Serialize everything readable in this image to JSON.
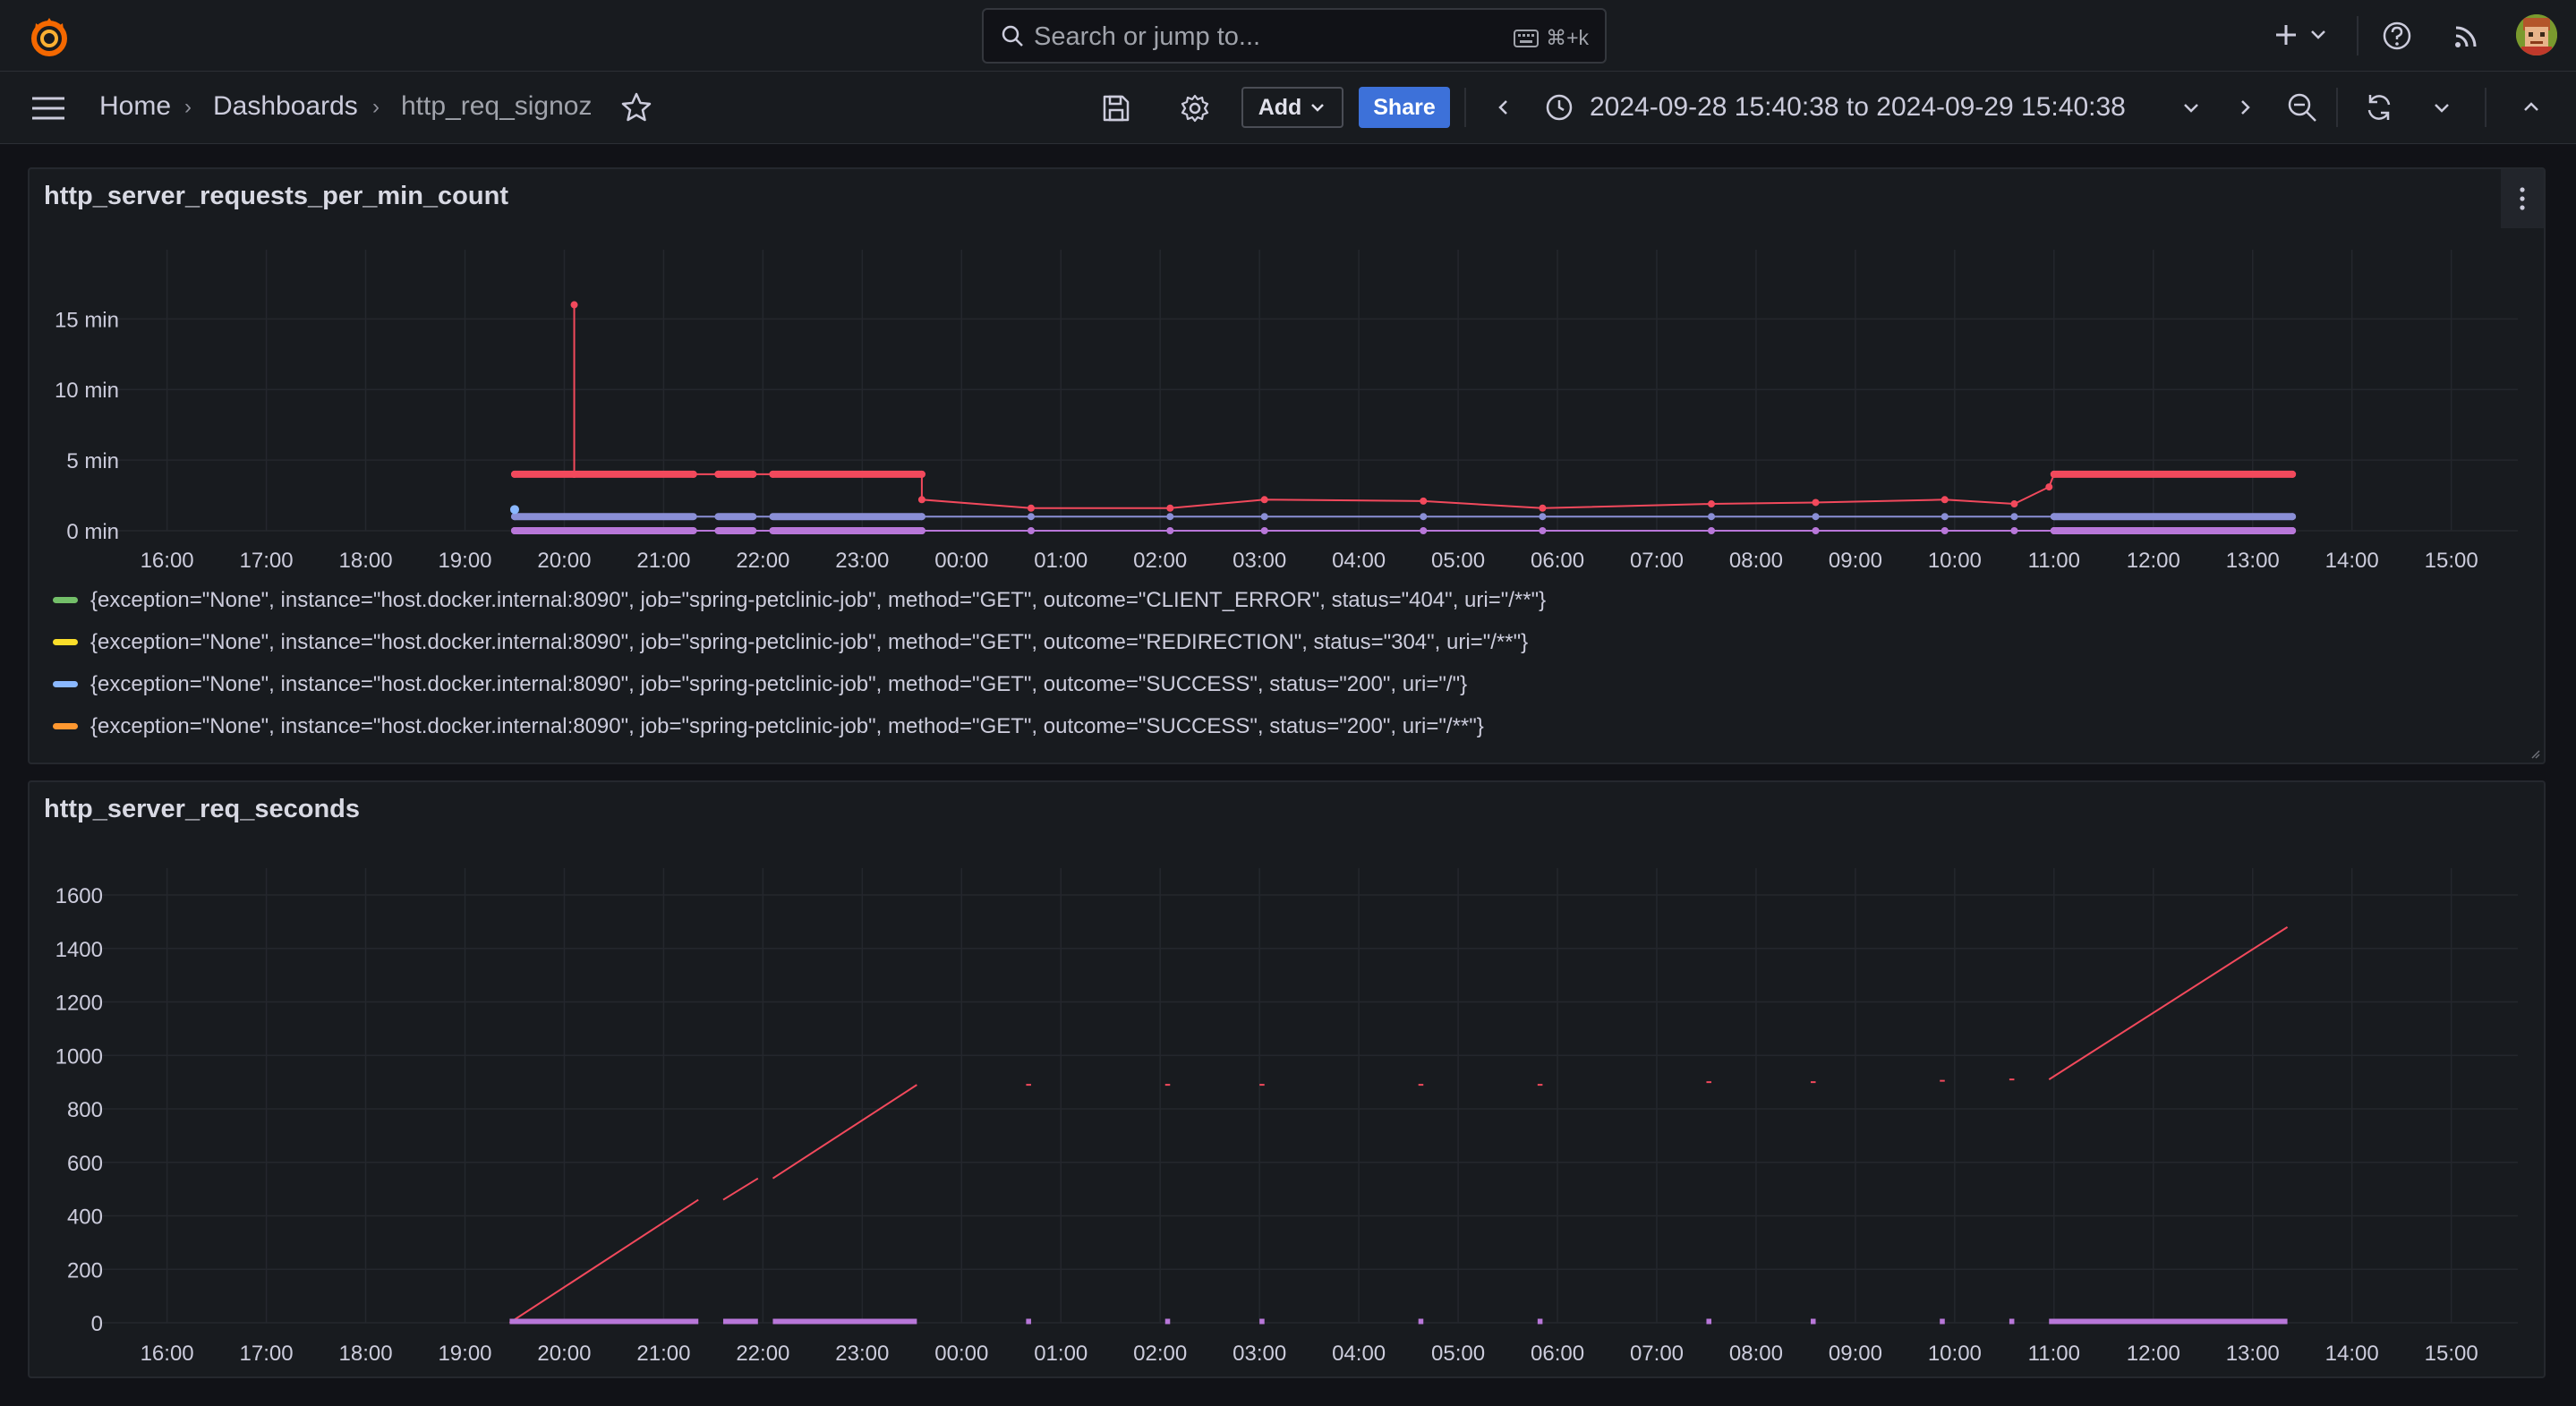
{
  "topbar": {
    "search_placeholder": "Search or jump to...",
    "search_shortcut": "⌘+k",
    "icons": [
      "grafana-logo-icon",
      "search-icon",
      "keyboard-icon",
      "plus-icon",
      "help-icon",
      "news-feed-icon"
    ]
  },
  "navbar": {
    "breadcrumbs": [
      "Home",
      "Dashboards",
      "http_req_signoz"
    ],
    "add_label": "Add",
    "share_label": "Share",
    "time_range": "2024-09-28 15:40:38 to 2024-09-29 15:40:38"
  },
  "colors": {
    "red": "#f2495c",
    "purple": "#b877d9",
    "blue": "#8ab8ff",
    "green": "#73bf69",
    "yellow": "#fade2a",
    "orange": "#ff9830",
    "share_blue": "#3d71d9"
  },
  "panels": [
    {
      "title": "http_server_requests_per_min_count",
      "legend": [
        {
          "label": "{exception=\"None\", instance=\"host.docker.internal:8090\", job=\"spring-petclinic-job\", method=\"GET\", outcome=\"CLIENT_ERROR\", status=\"404\", uri=\"/**\"}",
          "color": "#73bf69"
        },
        {
          "label": "{exception=\"None\", instance=\"host.docker.internal:8090\", job=\"spring-petclinic-job\", method=\"GET\", outcome=\"REDIRECTION\", status=\"304\", uri=\"/**\"}",
          "color": "#fade2a"
        },
        {
          "label": "{exception=\"None\", instance=\"host.docker.internal:8090\", job=\"spring-petclinic-job\", method=\"GET\", outcome=\"SUCCESS\", status=\"200\", uri=\"/\"}",
          "color": "#8ab8ff"
        },
        {
          "label": "{exception=\"None\", instance=\"host.docker.internal:8090\", job=\"spring-petclinic-job\", method=\"GET\", outcome=\"SUCCESS\", status=\"200\", uri=\"/**\"}",
          "color": "#ff9830"
        }
      ]
    },
    {
      "title": "http_server_req_seconds"
    }
  ],
  "chart_data": [
    {
      "type": "line",
      "title": "http_server_requests_per_min_count",
      "x_tick_labels": [
        "16:00",
        "17:00",
        "18:00",
        "19:00",
        "20:00",
        "21:00",
        "22:00",
        "23:00",
        "00:00",
        "01:00",
        "02:00",
        "03:00",
        "04:00",
        "05:00",
        "06:00",
        "07:00",
        "08:00",
        "09:00",
        "10:00",
        "11:00",
        "12:00",
        "13:00",
        "14:00",
        "15:00"
      ],
      "y_tick_labels": [
        "0 min",
        "5 min",
        "10 min",
        "15 min"
      ],
      "xlim_hours": [
        15.67,
        39.67
      ],
      "ylim": [
        0,
        18
      ],
      "y_unit": "min",
      "grid": true,
      "legend_placement": "bottom",
      "series": [
        {
          "color": "#f2495c",
          "points": [
            [
              19.5,
              4
            ],
            [
              20.1,
              4
            ],
            [
              20.1,
              16
            ],
            [
              20.1,
              4
            ],
            [
              21.3,
              4
            ],
            [
              21.55,
              4
            ],
            [
              21.55,
              4
            ],
            [
              21.9,
              4
            ],
            [
              22.1,
              4
            ],
            [
              23.6,
              4
            ],
            [
              23.6,
              2.2
            ],
            [
              24.7,
              1.6
            ],
            [
              26.1,
              1.6
            ],
            [
              27.05,
              2.2
            ],
            [
              28.65,
              2.1
            ],
            [
              29.85,
              1.6
            ],
            [
              31.55,
              1.9
            ],
            [
              32.6,
              2
            ],
            [
              33.9,
              2.2
            ],
            [
              34.6,
              1.9
            ],
            [
              34.95,
              3.1
            ],
            [
              35.0,
              4
            ],
            [
              37.4,
              4
            ]
          ]
        },
        {
          "color": "#8a8fd6",
          "points": [
            [
              19.5,
              1
            ],
            [
              23.6,
              1
            ],
            [
              24.7,
              1
            ],
            [
              26.1,
              1
            ],
            [
              27.05,
              1
            ],
            [
              28.65,
              1
            ],
            [
              29.85,
              1
            ],
            [
              31.55,
              1
            ],
            [
              32.6,
              1
            ],
            [
              33.9,
              1
            ],
            [
              34.6,
              1
            ],
            [
              35.0,
              1
            ],
            [
              37.4,
              1
            ]
          ]
        },
        {
          "color": "#b877d9",
          "points": [
            [
              19.5,
              0
            ],
            [
              23.6,
              0
            ],
            [
              24.7,
              0
            ],
            [
              26.1,
              0
            ],
            [
              27.05,
              0
            ],
            [
              28.65,
              0
            ],
            [
              29.85,
              0
            ],
            [
              31.55,
              0
            ],
            [
              32.6,
              0
            ],
            [
              33.9,
              0
            ],
            [
              34.6,
              0
            ],
            [
              35.0,
              0
            ],
            [
              37.4,
              0
            ]
          ]
        }
      ]
    },
    {
      "type": "line",
      "title": "http_server_req_seconds",
      "x_tick_labels": [
        "16:00",
        "17:00",
        "18:00",
        "19:00",
        "20:00",
        "21:00",
        "22:00",
        "23:00",
        "00:00",
        "01:00",
        "02:00",
        "03:00",
        "04:00",
        "05:00",
        "06:00",
        "07:00",
        "08:00",
        "09:00",
        "10:00",
        "11:00",
        "12:00",
        "13:00",
        "14:00",
        "15:00"
      ],
      "y_tick_labels": [
        "0",
        "200",
        "400",
        "600",
        "800",
        "1000",
        "1200",
        "1400",
        "1600"
      ],
      "xlim_hours": [
        15.67,
        39.67
      ],
      "ylim": [
        0,
        1600
      ],
      "grid": true,
      "series": [
        {
          "color": "#f2495c",
          "segments": [
            [
              [
                19.45,
                0
              ],
              [
                21.35,
                460
              ]
            ],
            [
              [
                21.6,
                460
              ],
              [
                21.95,
                540
              ]
            ],
            [
              [
                22.1,
                540
              ],
              [
                23.55,
                890
              ]
            ],
            [
              [
                24.65,
                890
              ],
              [
                24.7,
                890
              ]
            ],
            [
              [
                26.05,
                890
              ],
              [
                26.1,
                890
              ]
            ],
            [
              [
                27.0,
                890
              ],
              [
                27.05,
                890
              ]
            ],
            [
              [
                28.6,
                890
              ],
              [
                28.65,
                890
              ]
            ],
            [
              [
                29.8,
                890
              ],
              [
                29.85,
                890
              ]
            ],
            [
              [
                31.5,
                900
              ],
              [
                31.55,
                900
              ]
            ],
            [
              [
                32.55,
                900
              ],
              [
                32.6,
                900
              ]
            ],
            [
              [
                33.85,
                905
              ],
              [
                33.9,
                905
              ]
            ],
            [
              [
                34.55,
                910
              ],
              [
                34.6,
                910
              ]
            ],
            [
              [
                34.95,
                910
              ],
              [
                37.35,
                1480
              ]
            ]
          ]
        },
        {
          "color": "#b877d9",
          "segments": [
            [
              [
                19.45,
                5
              ],
              [
                21.35,
                5
              ]
            ],
            [
              [
                21.6,
                5
              ],
              [
                21.95,
                5
              ]
            ],
            [
              [
                22.1,
                5
              ],
              [
                23.55,
                5
              ]
            ],
            [
              [
                24.65,
                5
              ],
              [
                24.7,
                5
              ]
            ],
            [
              [
                26.05,
                5
              ],
              [
                26.1,
                5
              ]
            ],
            [
              [
                27.0,
                5
              ],
              [
                27.05,
                5
              ]
            ],
            [
              [
                28.6,
                5
              ],
              [
                28.65,
                5
              ]
            ],
            [
              [
                29.8,
                5
              ],
              [
                29.85,
                5
              ]
            ],
            [
              [
                31.5,
                5
              ],
              [
                31.55,
                5
              ]
            ],
            [
              [
                32.55,
                5
              ],
              [
                32.6,
                5
              ]
            ],
            [
              [
                33.85,
                5
              ],
              [
                33.9,
                5
              ]
            ],
            [
              [
                34.55,
                5
              ],
              [
                34.6,
                5
              ]
            ],
            [
              [
                34.95,
                5
              ],
              [
                37.35,
                5
              ]
            ]
          ]
        }
      ]
    }
  ]
}
